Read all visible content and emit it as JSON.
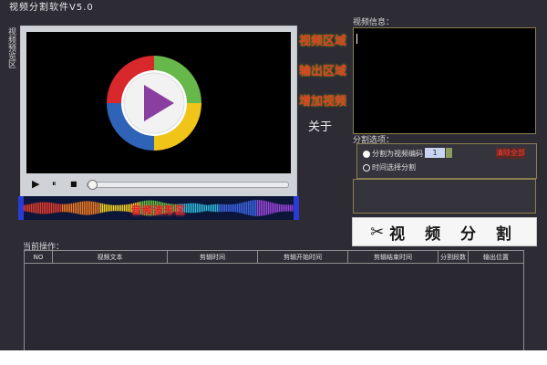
{
  "window": {
    "title": "视频分割软件V5.0"
  },
  "left_tab": {
    "label": "视频预览区"
  },
  "player": {
    "controls": {
      "play": "▶",
      "pause": "⏸",
      "stop": "■"
    },
    "progress": 0.0,
    "waveform_label": "音频波形区"
  },
  "menu": {
    "video_area": "视频区域",
    "output_area": "输出区域",
    "add_video": "增加视频",
    "about": "关于"
  },
  "info_panel": {
    "label": "视频信息："
  },
  "split_options": {
    "label": "分割选项：",
    "option_by_count": "分割为视频编码",
    "option_by_time": "时间选择分割",
    "value": "1",
    "clear_button": "清除全部"
  },
  "split_button": {
    "label": "视 频 分 割"
  },
  "operations": {
    "label": "当前操作：",
    "columns": [
      "NO",
      "视频文本",
      "剪辑时间",
      "剪辑开始时间",
      "剪辑结束时间",
      "分割段数",
      "输出位置"
    ]
  },
  "colors": {
    "background": "#2d2c35",
    "menu_red": "#e63d2a",
    "menu_green": "#67c63e",
    "panel_border": "#8a7f4e"
  },
  "icons": [
    "play-icon",
    "pause-icon",
    "stop-icon",
    "scissors-icon",
    "media-player-logo-icon"
  ]
}
